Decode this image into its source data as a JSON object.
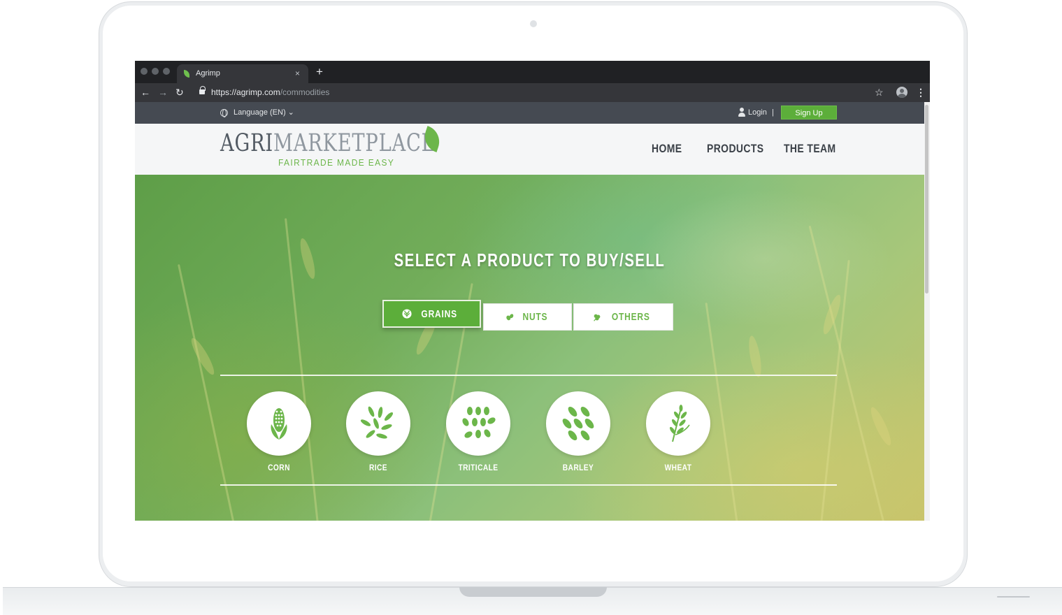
{
  "browser": {
    "tab_title": "Agrimp",
    "close_glyph": "×",
    "new_tab_glyph": "+",
    "url_host": "https://agrimp.com",
    "url_path": "/commodities"
  },
  "topbar": {
    "language": "Language (EN)",
    "login": "Login",
    "separator": "|",
    "signup": "Sign Up"
  },
  "header": {
    "logo_primary": "AGRI",
    "logo_secondary": "MARKETPLACE",
    "tagline": "FAIRTRADE MADE EASY",
    "nav": [
      "HOME",
      "PRODUCTS",
      "THE TEAM"
    ]
  },
  "hero": {
    "title": "SELECT A PRODUCT TO BUY/SELL",
    "categories": [
      {
        "label": "GRAINS",
        "icon": "grains-icon",
        "active": true
      },
      {
        "label": "NUTS",
        "icon": "nuts-icon",
        "active": false
      },
      {
        "label": "OTHERS",
        "icon": "others-icon",
        "active": false
      }
    ],
    "products": [
      {
        "label": "CORN",
        "icon": "corn-icon"
      },
      {
        "label": "RICE",
        "icon": "rice-icon"
      },
      {
        "label": "TRITICALE",
        "icon": "triticale-icon"
      },
      {
        "label": "BARLEY",
        "icon": "barley-icon"
      },
      {
        "label": "WHEAT",
        "icon": "wheat-icon"
      }
    ]
  },
  "colors": {
    "brand_green": "#5cae3a",
    "icon_green": "#6cb64a",
    "topbar": "#454a52",
    "header_bg": "#f5f6f7"
  }
}
